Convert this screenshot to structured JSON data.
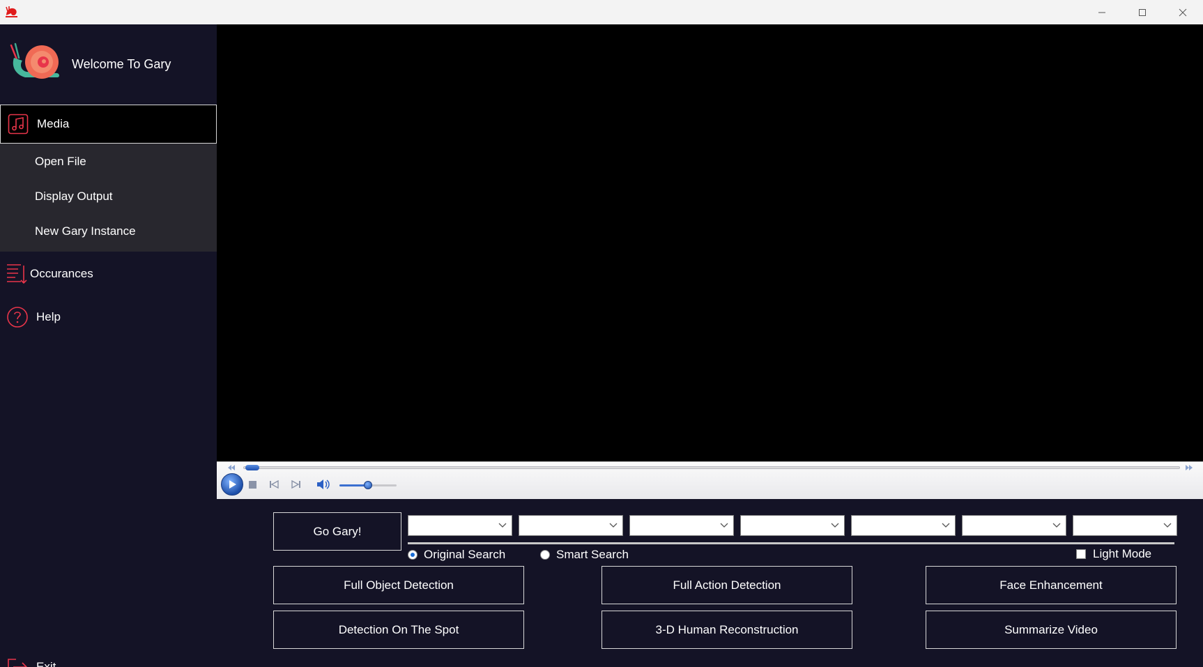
{
  "window": {
    "minimize_icon": "minimize-icon",
    "maximize_icon": "maximize-icon",
    "close_icon": "close-icon"
  },
  "sidebar": {
    "brand_title": "Welcome To Gary",
    "media_label": "Media",
    "submenu": [
      "Open File",
      "Display Output",
      "New Gary Instance"
    ],
    "occurances_label": "Occurances",
    "help_label": "Help",
    "exit_label": "Exit"
  },
  "player": {
    "seek_progress": 0.01,
    "volume": 0.5
  },
  "controls": {
    "go_label": "Go Gary!",
    "dropdowns": [
      "",
      "",
      "",
      "",
      "",
      "",
      ""
    ],
    "search_modes": [
      {
        "label": "Original Search",
        "selected": true
      },
      {
        "label": "Smart Search",
        "selected": false
      }
    ],
    "light_mode_label": "Light Mode",
    "light_mode_checked": false,
    "buttons": {
      "full_object_detection": "Full Object Detection",
      "full_action_detection": "Full Action Detection",
      "face_enhancement": "Face Enhancement",
      "detection_on_the_spot": "Detection On The Spot",
      "human_reconstruction": "3-D Human Reconstruction",
      "summarize_video": "Summarize Video"
    }
  },
  "colors": {
    "accent": "#e8354a",
    "sidebar_bg": "#141326",
    "submenu_bg": "#28272e"
  }
}
